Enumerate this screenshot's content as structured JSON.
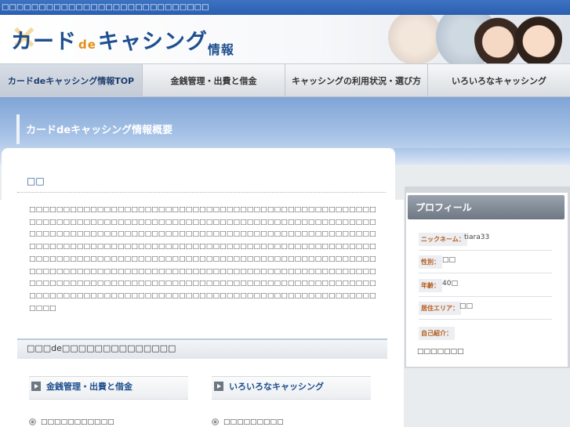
{
  "topbar": {
    "text": "□□□□□□□□□□□□□□□□□□□□□□□□□□□□"
  },
  "header": {
    "logo_main": "カード",
    "logo_de": "de",
    "logo_tail": "キャシング",
    "logo_small": "情報"
  },
  "nav": {
    "items": [
      {
        "label": "カードdeキャッシング情報TOP"
      },
      {
        "label": "金銭管理・出費と借金"
      },
      {
        "label": "キャッシングの利用状況・選び方"
      },
      {
        "label": "いろいろなキャッシング"
      }
    ]
  },
  "banner": {
    "title": "カードdeキャッシング情報概要"
  },
  "main": {
    "section_title": "□□",
    "paragraph": "□□□□□□□□□□□□□□□□□□□□□□□□□□□□□□□□□□□□□□□□□□□□□□□□□□□□□□□□□□□□□□□□□□□□□□□□□□□□□□□□□□□□□□□□□□□□□□□□□□□□□□□□□□□□□□□□□□□□□□□□□□□□□□□□□□□□□□□□□□□□□□□□□□□□□□□□□□□□□□□□□□□□□□□□□□□□□□□□□□□□□□□□□□□□□□□□□□□□□□□□□□□□□□□□□□□□□□□□□□□□□□□□□□□□□□□□□□□□□□□□□□□□□□□□□□□□□□□□□□□□□□□□□□□□□□□□□□□□□□□□□□□□□□□□□□□□□□□□□□□□□□□□□□□□□□□□□□□□□□□□□□□□□□□□□□□□□□□□□□□□□□□□□□□□□□□□□□□□□□□□□□□□□□□□□□□□□□□□□□□□□□□□□□□□□□□□□□□□□□□□□□□□□□□□□□□□",
    "subhead": "□□□de□□□□□□□□□□□□□□",
    "cards": [
      {
        "label": "金銭管理・出費と借金"
      },
      {
        "label": "いろいろなキャッシング"
      }
    ],
    "links": [
      {
        "label": "□□□□□□□□□□□"
      },
      {
        "label": "□□□□□□□□□"
      }
    ]
  },
  "profile": {
    "header": "プロフィール",
    "rows": [
      {
        "label": "ニックネーム：",
        "value": "tiara33"
      },
      {
        "label": "性別：",
        "value": "□□"
      },
      {
        "label": "年齢：",
        "value": "40□"
      },
      {
        "label": "居住エリア：",
        "value": "□□"
      },
      {
        "label": "自己紹介：",
        "value": ""
      }
    ],
    "intro_text": "□□□□□□□"
  }
}
